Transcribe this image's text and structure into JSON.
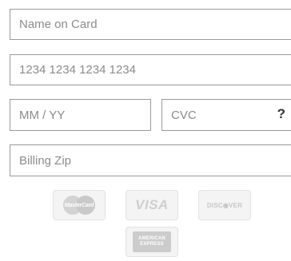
{
  "form": {
    "name_on_card": {
      "placeholder": "Name on Card",
      "value": ""
    },
    "card_number": {
      "placeholder": "1234 1234 1234 1234",
      "value": ""
    },
    "expiry": {
      "placeholder": "MM / YY",
      "value": ""
    },
    "cvc": {
      "placeholder": "CVC",
      "value": "",
      "help_label": "?"
    },
    "billing_zip": {
      "placeholder": "Billing Zip",
      "value": ""
    }
  },
  "card_logos": {
    "mastercard": {
      "icon": "mastercard-logo-icon",
      "text": "MasterCard"
    },
    "visa": {
      "icon": "visa-logo-icon",
      "text": "VISA"
    },
    "discover": {
      "icon": "discover-logo-icon",
      "text": "DISC◉VER"
    },
    "amex": {
      "icon": "american-express-logo-icon",
      "line1": "AMERICAN",
      "line2": "EXPRESS"
    }
  },
  "colors": {
    "field_border": "#9a9a9a",
    "placeholder_text": "#8b8b8b",
    "logo_gray": "#cccccc"
  }
}
